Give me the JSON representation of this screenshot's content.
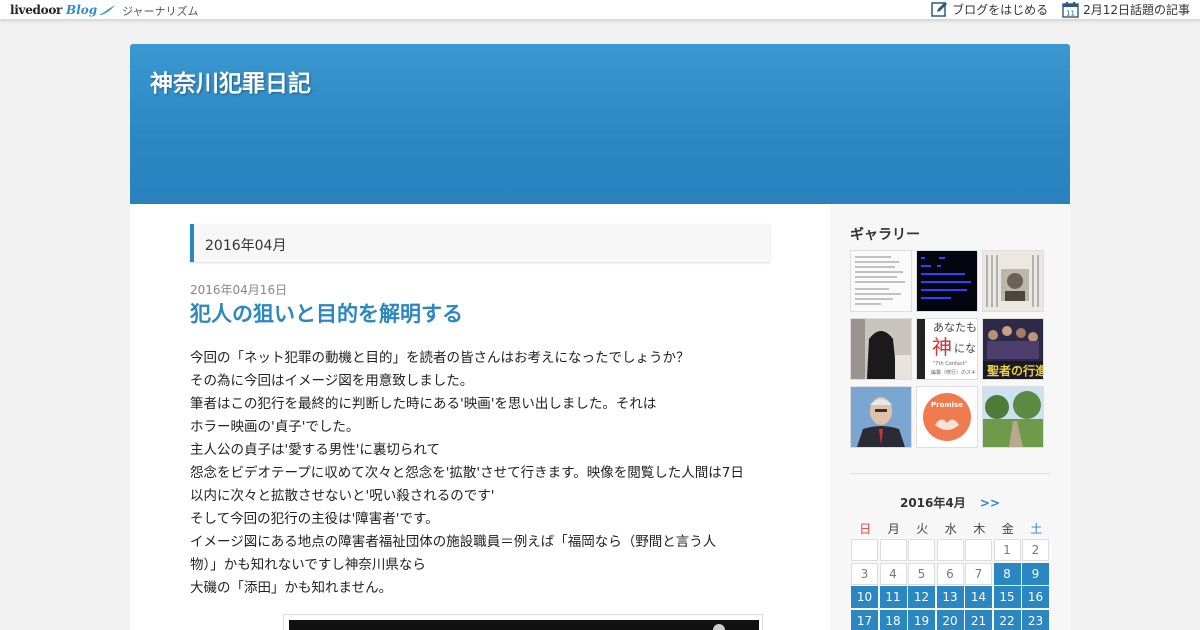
{
  "topbar": {
    "logo_main": "livedoor",
    "logo_sub": "Blog",
    "nav_label": "ジャーナリズム",
    "start_blog_label": "ブログをはじめる",
    "topic_label": "2月12日話題の記事",
    "calendar_icon_day": "11"
  },
  "header": {
    "site_title": "神奈川犯罪日記"
  },
  "main": {
    "archive_label": "2016年04月",
    "post": {
      "date": "2016年04月16日",
      "title": "犯人の狙いと目的を解明する",
      "body_lines": [
        "今回の「ネット犯罪の動機と目的」を読者の皆さんはお考えになったでしょうか？",
        "その為に今回はイメージ図を用意致しました。",
        "筆者はこの犯行を最終的に判断した時にある'映画'を思い出しました。それは",
        "ホラー映画の'貞子'でした。",
        "主人公の貞子は'愛する男性'に裏切られて",
        "怨念をビデオテープに収めて次々と怨念を'拡散'させて行きます。映像を閲覧した人間は7日",
        "以内に次々と拡散させないと'呪い殺されるのです'",
        "そして今回の犯行の主役は'障害者'です。",
        "イメージ図にある地点の障害者福祉団体の施設職員＝例えば「福岡なら（野間と言う人",
        "物）」かも知れないですし神奈川県なら",
        "大磯の「添田」かも知れません。"
      ]
    }
  },
  "sidebar": {
    "gallery_title": "ギャラリー",
    "thumb_texts": {
      "t5_line1": "あなたも",
      "t5_big": "神",
      "t5_after": "にな",
      "t5_line3": "\"7th Contact\"",
      "t5_line4": "編纂（修行）のスキ",
      "t6_text": "聖者の行進",
      "t8_text": "Promise"
    },
    "calendar": {
      "month_label": "2016年4月",
      "next_label": ">>",
      "weekdays": [
        "日",
        "月",
        "火",
        "水",
        "木",
        "金",
        "土"
      ],
      "rows": [
        [
          "",
          "",
          "",
          "",
          "",
          "1",
          "2"
        ],
        [
          "3",
          "4",
          "5",
          "6",
          "7",
          "8",
          "9"
        ],
        [
          "10",
          "11",
          "12",
          "13",
          "14",
          "15",
          "16"
        ],
        [
          "17",
          "18",
          "19",
          "20",
          "21",
          "22",
          "23"
        ]
      ],
      "linked_days": [
        "8",
        "9",
        "10",
        "11",
        "12",
        "13",
        "14",
        "15",
        "16",
        "17",
        "18",
        "19",
        "20",
        "21",
        "22",
        "23"
      ]
    }
  },
  "colors": {
    "accent": "#2b87c2",
    "sunday": "#e04040"
  }
}
